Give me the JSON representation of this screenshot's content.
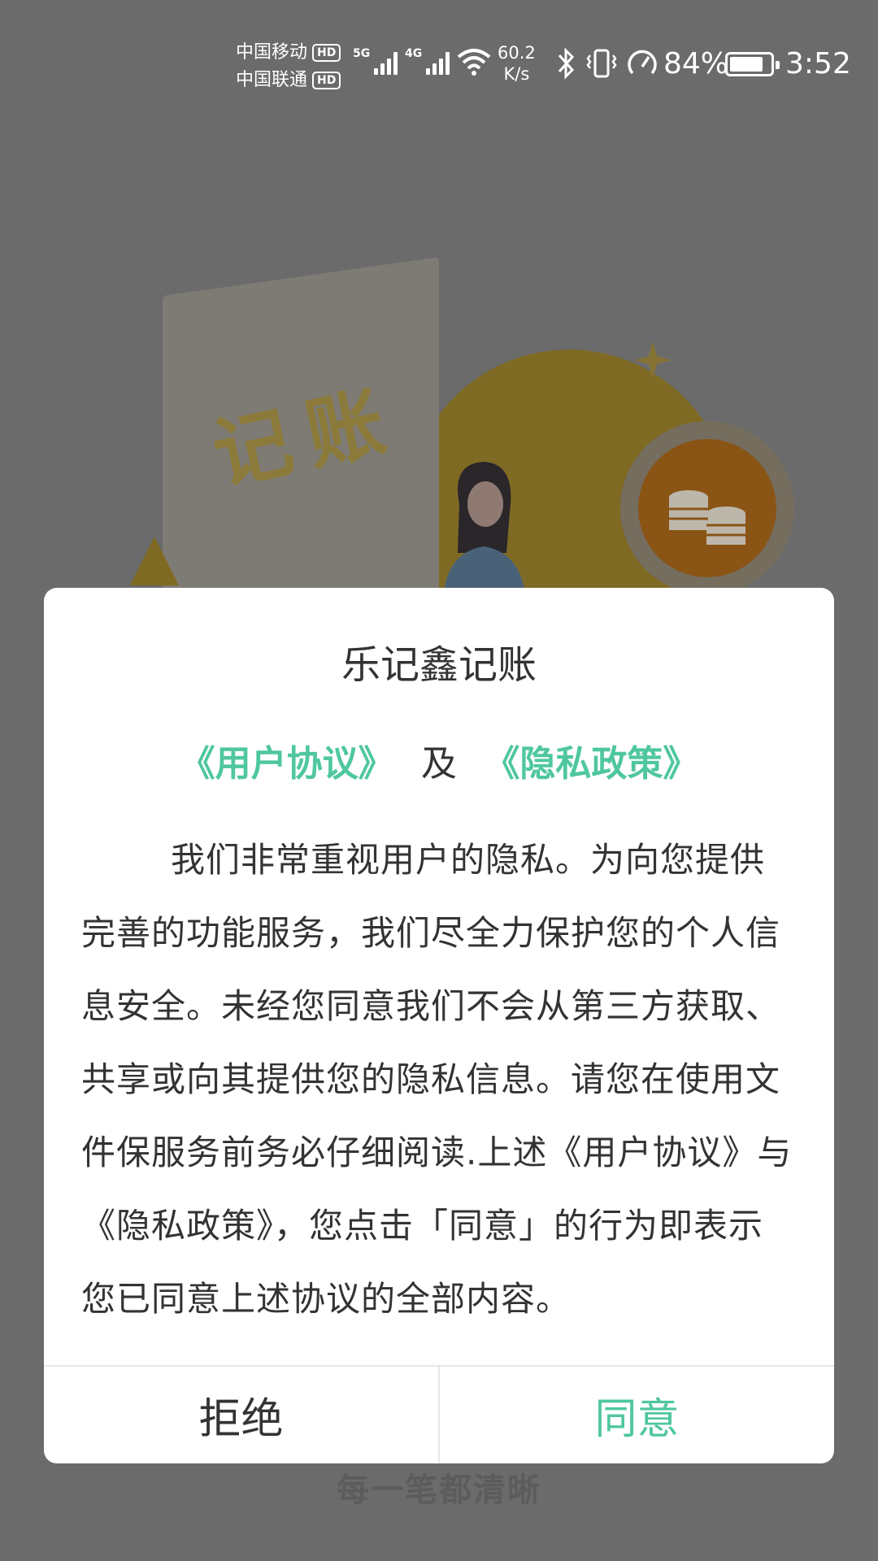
{
  "status_bar": {
    "carrier_1": "中国移动",
    "carrier_2": "中国联通",
    "hd_badge": "HD",
    "network_1": "5G",
    "network_2": "4G",
    "speed_value": "60.2",
    "speed_unit": "K/s",
    "battery_percent": "84%",
    "battery_level": 0.84,
    "time": "3:52"
  },
  "background": {
    "card_text": "记账",
    "slogan": "每一笔都清晰"
  },
  "dialog": {
    "title": "乐记鑫记账",
    "user_agreement_link": "《用户协议》",
    "links_connector": "及",
    "privacy_policy_link": "《隐私政策》",
    "body": "我们非常重视用户的隐私。为向您提供完善的功能服务，我们尽全力保护您的个人信息安全。未经您同意我们不会从第三方获取、共享或向其提供您的隐私信息。请您在使用文件保服务前务必仔细阅读.上述《用户协议》与《隐私政策》，您点击「同意」的行为即表示您已同意上述协议的全部内容。",
    "refuse_label": "拒绝",
    "agree_label": "同意"
  },
  "colors": {
    "accent": "#4fc79e",
    "overlay": "#6b6b6b",
    "text": "#333333"
  }
}
